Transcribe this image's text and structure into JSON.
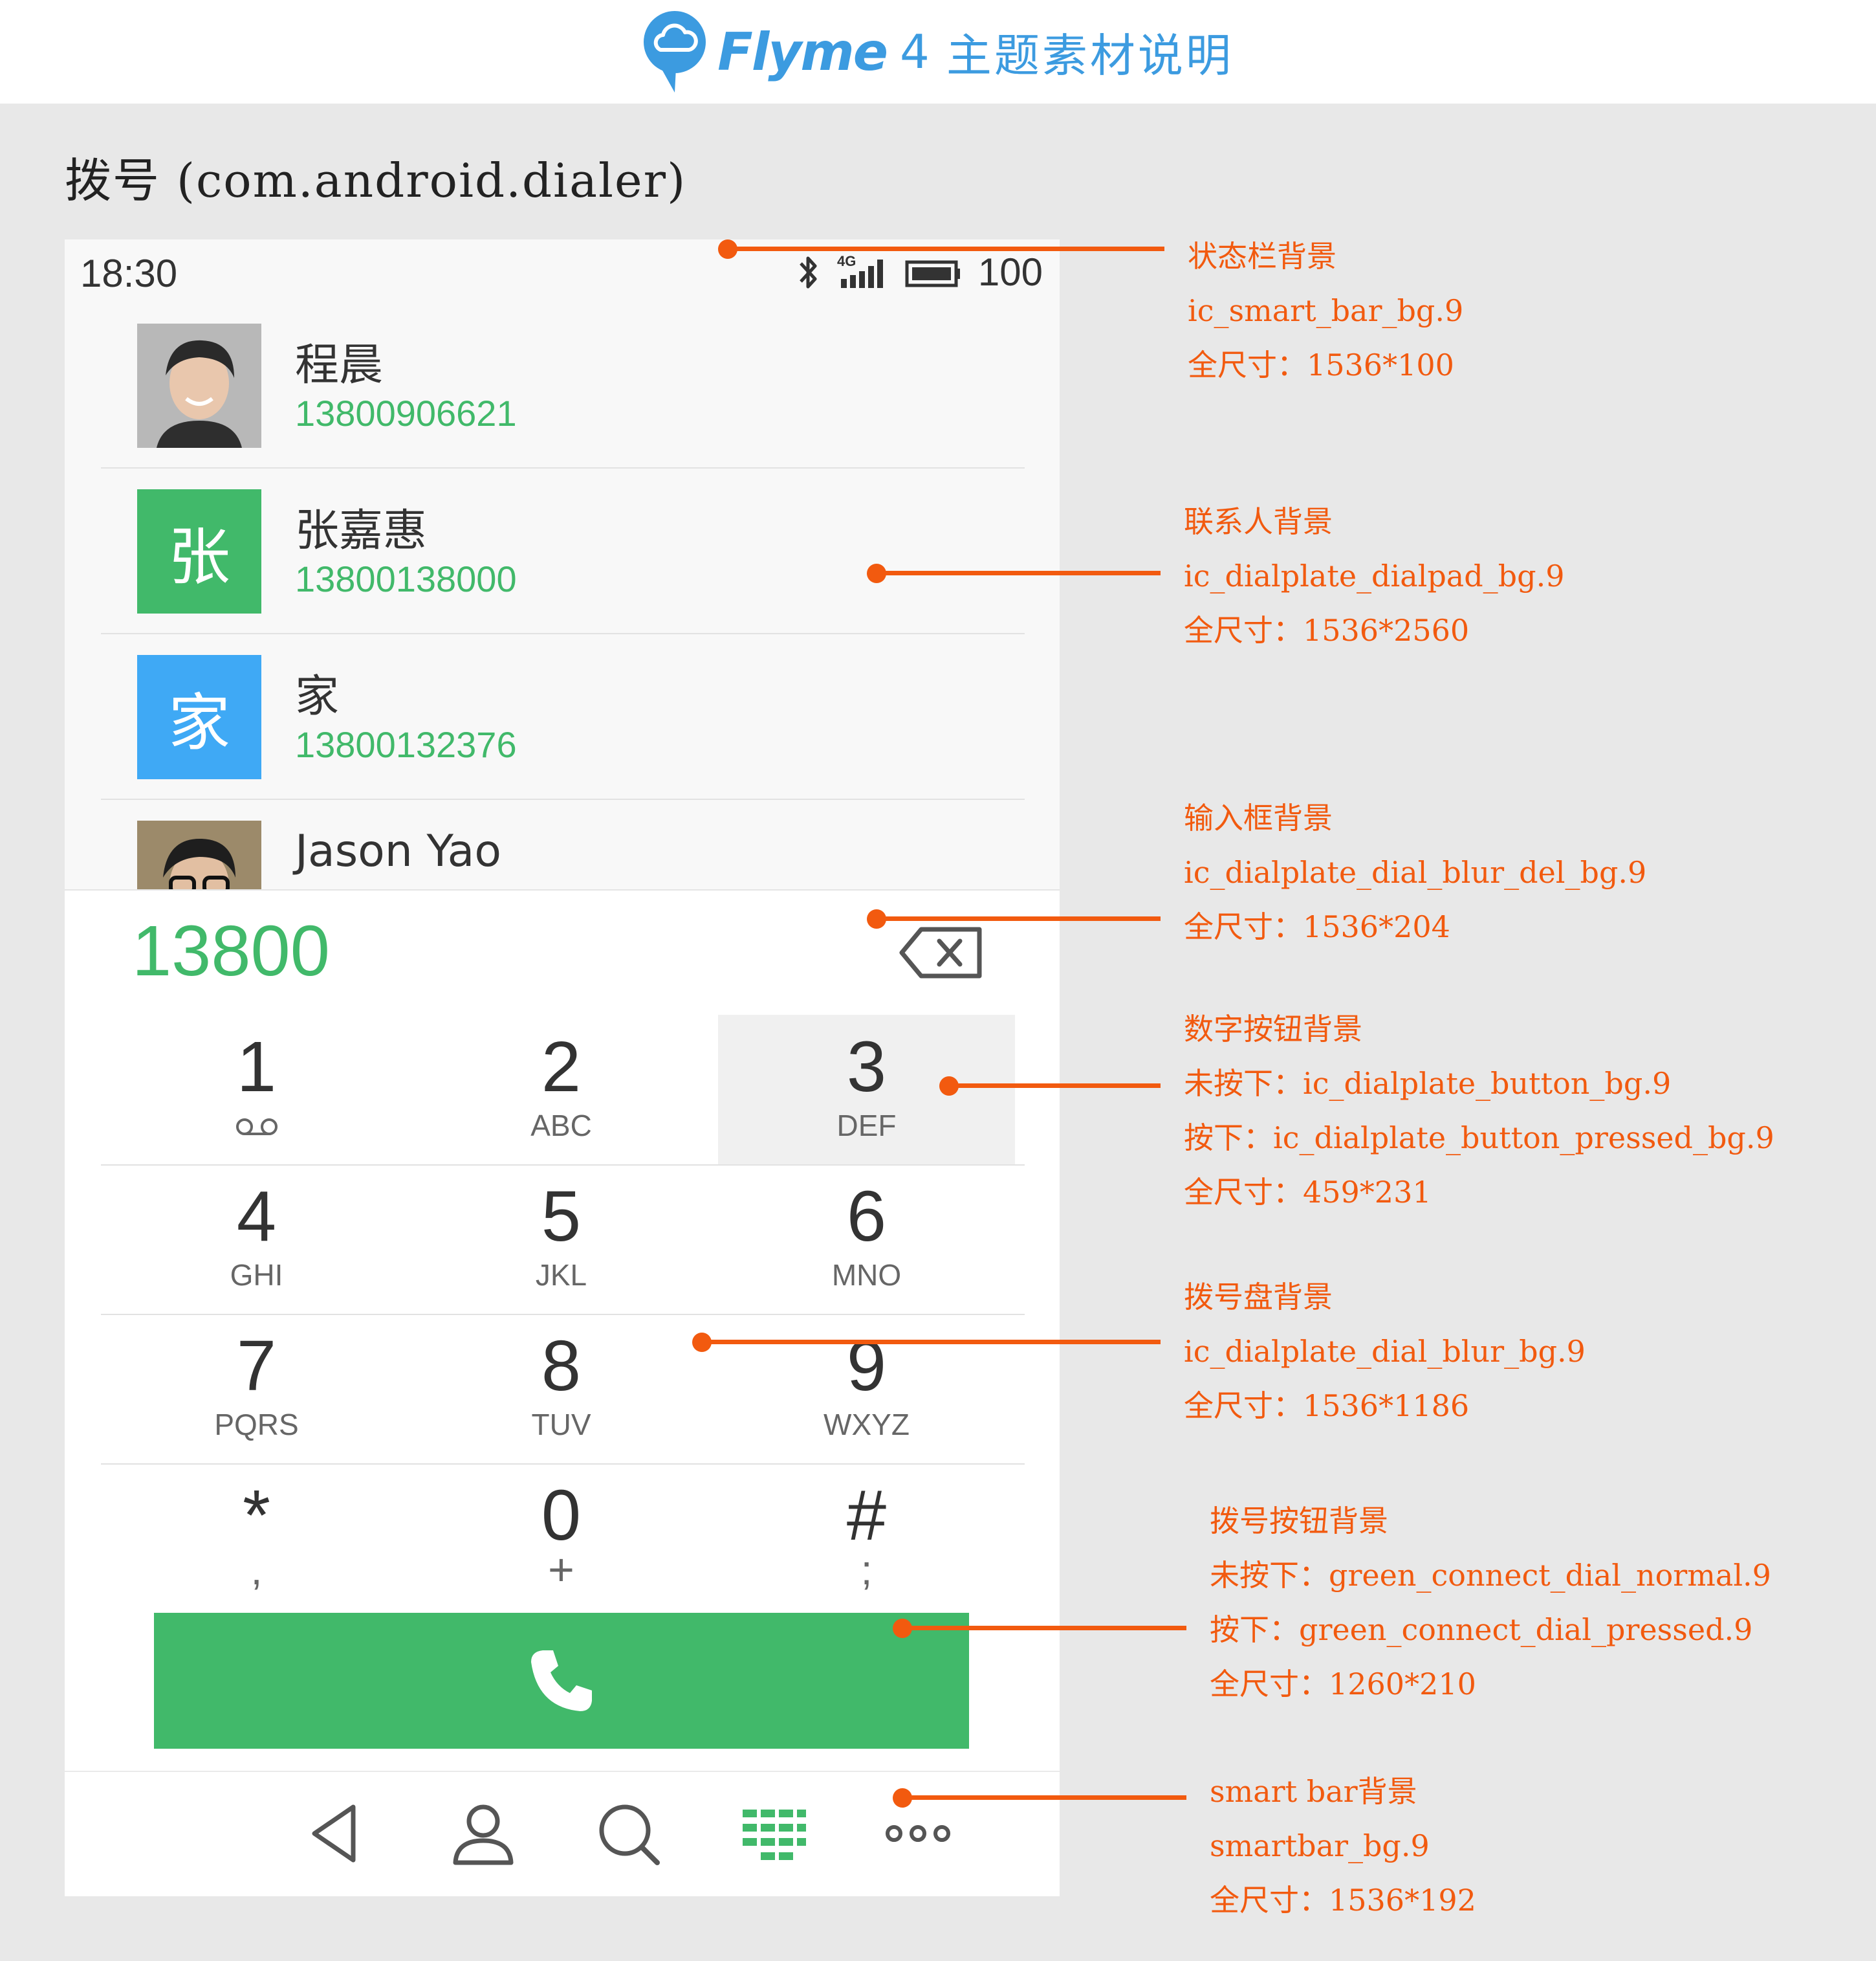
{
  "header": {
    "brand_name": "Flyme",
    "brand_version": "4",
    "subtitle": "主题素材说明",
    "brand_color": "#3c9be0"
  },
  "page_title": "拨号 (com.android.dialer)",
  "phone": {
    "status_bar": {
      "time": "18:30",
      "battery": "100",
      "icons": [
        "bluetooth-icon",
        "4g-signal-icon",
        "battery-icon"
      ],
      "network_label": "4G"
    },
    "contacts": [
      {
        "name": "程晨",
        "number": "13800906621",
        "avatar": "photo"
      },
      {
        "name": "张嘉惠",
        "number": "13800138000",
        "avatar": "张",
        "avatar_color": "#41b96a"
      },
      {
        "name": "家",
        "number": "13800132376",
        "avatar": "家",
        "avatar_color": "#3fa9f5"
      },
      {
        "name": "Jason Yao",
        "number": "",
        "avatar": "photo"
      }
    ],
    "input_value": "13800",
    "keys": [
      {
        "digit": "1",
        "letters": "voicemail-icon"
      },
      {
        "digit": "2",
        "letters": "ABC"
      },
      {
        "digit": "3",
        "letters": "DEF"
      },
      {
        "digit": "4",
        "letters": "GHI"
      },
      {
        "digit": "5",
        "letters": "JKL"
      },
      {
        "digit": "6",
        "letters": "MNO"
      },
      {
        "digit": "7",
        "letters": "PQRS"
      },
      {
        "digit": "8",
        "letters": "TUV"
      },
      {
        "digit": "9",
        "letters": "WXYZ"
      },
      {
        "digit": "*",
        "letters": ","
      },
      {
        "digit": "0",
        "letters": "+"
      },
      {
        "digit": "#",
        "letters": ";"
      }
    ],
    "accent_color": "#41b96a",
    "smartbar_icons": [
      "back-icon",
      "contacts-icon",
      "search-icon",
      "dialpad-icon",
      "more-icon"
    ]
  },
  "annotations": [
    {
      "title": "状态栏背景",
      "lines": [
        "ic_smart_bar_bg.9",
        "全尺寸：1536*100"
      ]
    },
    {
      "title": "联系人背景",
      "lines": [
        "ic_dialplate_dialpad_bg.9",
        "全尺寸：1536*2560"
      ]
    },
    {
      "title": "输入框背景",
      "lines": [
        "ic_dialplate_dial_blur_del_bg.9",
        "全尺寸：1536*204"
      ]
    },
    {
      "title": "数字按钮背景",
      "lines": [
        "未按下：ic_dialplate_button_bg.9",
        "按下：ic_dialplate_button_pressed_bg.9",
        "全尺寸：459*231"
      ]
    },
    {
      "title": "拨号盘背景",
      "lines": [
        "ic_dialplate_dial_blur_bg.9",
        "全尺寸：1536*1186"
      ]
    },
    {
      "title": "拨号按钮背景",
      "lines": [
        "未按下：green_connect_dial_normal.9",
        "按下：green_connect_dial_pressed.9",
        "全尺寸：1260*210"
      ]
    },
    {
      "title": "smart bar背景",
      "lines": [
        "smartbar_bg.9",
        "全尺寸：1536*192"
      ]
    }
  ],
  "annotation_color": "#f25a0f"
}
